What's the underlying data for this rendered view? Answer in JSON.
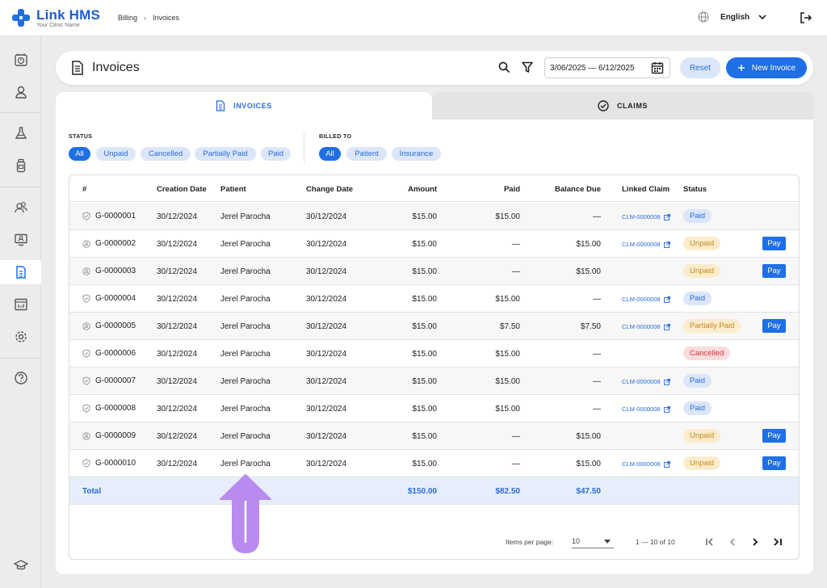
{
  "app": {
    "name": "Link HMS",
    "subtitle": "Your Clinic Name"
  },
  "breadcrumb": [
    "Billing",
    "Invoices"
  ],
  "header": {
    "language": "English"
  },
  "page": {
    "title": "Invoices",
    "date_range": "3/06/2025 — 6/12/2025",
    "reset_label": "Reset",
    "new_invoice_label": "New Invoice"
  },
  "tabs": [
    {
      "label": "INVOICES",
      "active": true
    },
    {
      "label": "CLAIMS",
      "active": false
    }
  ],
  "filters": {
    "status": {
      "label": "STATUS",
      "options": [
        "All",
        "Unpaid",
        "Cancelled",
        "Partially Paid",
        "Paid"
      ],
      "selected": "All"
    },
    "billed_to": {
      "label": "BILLED TO",
      "options": [
        "All",
        "Patient",
        "Insurance"
      ],
      "selected": "All"
    }
  },
  "table": {
    "columns": [
      "#",
      "Creation Date",
      "Patient",
      "Change Date",
      "Amount",
      "Paid",
      "Balance Due",
      "Linked Claim",
      "Status"
    ],
    "rows": [
      {
        "id": "G-0000001",
        "billed_icon": "shield-icon",
        "created": "30/12/2024",
        "patient": "Jerel Parocha",
        "changed": "30/12/2024",
        "amount": "$15.00",
        "paid": "$15.00",
        "balance": "—",
        "claim": "CLM-0000008",
        "status": "Paid",
        "pay": ""
      },
      {
        "id": "G-0000002",
        "billed_icon": "person-icon",
        "created": "30/12/2024",
        "patient": "Jerel Parocha",
        "changed": "30/12/2024",
        "amount": "$15.00",
        "paid": "—",
        "balance": "$15.00",
        "claim": "CLM-0000008",
        "status": "Unpaid",
        "pay": "Pay"
      },
      {
        "id": "G-0000003",
        "billed_icon": "person-icon",
        "created": "30/12/2024",
        "patient": "Jerel Parocha",
        "changed": "30/12/2024",
        "amount": "$15.00",
        "paid": "—",
        "balance": "$15.00",
        "claim": "",
        "status": "Unpaid",
        "pay": "Pay"
      },
      {
        "id": "G-0000004",
        "billed_icon": "shield-icon",
        "created": "30/12/2024",
        "patient": "Jerel Parocha",
        "changed": "30/12/2024",
        "amount": "$15.00",
        "paid": "$15.00",
        "balance": "—",
        "claim": "CLM-0000008",
        "status": "Paid",
        "pay": ""
      },
      {
        "id": "G-0000005",
        "billed_icon": "person-icon",
        "created": "30/12/2024",
        "patient": "Jerel Parocha",
        "changed": "30/12/2024",
        "amount": "$15.00",
        "paid": "$7.50",
        "balance": "$7.50",
        "claim": "CLM-0000008",
        "status": "Partially Paid",
        "pay": "Pay"
      },
      {
        "id": "G-0000006",
        "billed_icon": "shield-icon",
        "created": "30/12/2024",
        "patient": "Jerel Parocha",
        "changed": "30/12/2024",
        "amount": "$15.00",
        "paid": "$15.00",
        "balance": "—",
        "claim": "",
        "status": "Cancelled",
        "pay": ""
      },
      {
        "id": "G-0000007",
        "billed_icon": "shield-icon",
        "created": "30/12/2024",
        "patient": "Jerel Parocha",
        "changed": "30/12/2024",
        "amount": "$15.00",
        "paid": "$15.00",
        "balance": "—",
        "claim": "CLM-0000008",
        "status": "Paid",
        "pay": ""
      },
      {
        "id": "G-0000008",
        "billed_icon": "shield-icon",
        "created": "30/12/2024",
        "patient": "Jerel Parocha",
        "changed": "30/12/2024",
        "amount": "$15.00",
        "paid": "$15.00",
        "balance": "—",
        "claim": "CLM-0000008",
        "status": "Paid",
        "pay": ""
      },
      {
        "id": "G-0000009",
        "billed_icon": "person-icon",
        "created": "30/12/2024",
        "patient": "Jerel Parocha",
        "changed": "30/12/2024",
        "amount": "$15.00",
        "paid": "—",
        "balance": "$15.00",
        "claim": "",
        "status": "Unpaid",
        "pay": "Pay"
      },
      {
        "id": "G-0000010",
        "billed_icon": "shield-icon",
        "created": "30/12/2024",
        "patient": "Jerel Parocha",
        "changed": "30/12/2024",
        "amount": "$15.00",
        "paid": "—",
        "balance": "$15.00",
        "claim": "CLM-0000008",
        "status": "Unpaid",
        "pay": "Pay"
      }
    ],
    "total": {
      "label": "Total",
      "amount": "$150.00",
      "paid": "$82.50",
      "balance": "$47.50"
    }
  },
  "pagination": {
    "items_per_page_label": "Items per page:",
    "items_per_page": "10",
    "range": "1 — 10 of 10"
  },
  "colors": {
    "primary": "#1f6fe5",
    "primary_soft": "#dbe6f9",
    "warning_soft": "#fbeccd",
    "danger_soft": "#fbdbdb",
    "annotation_arrow": "#b98bf0"
  }
}
